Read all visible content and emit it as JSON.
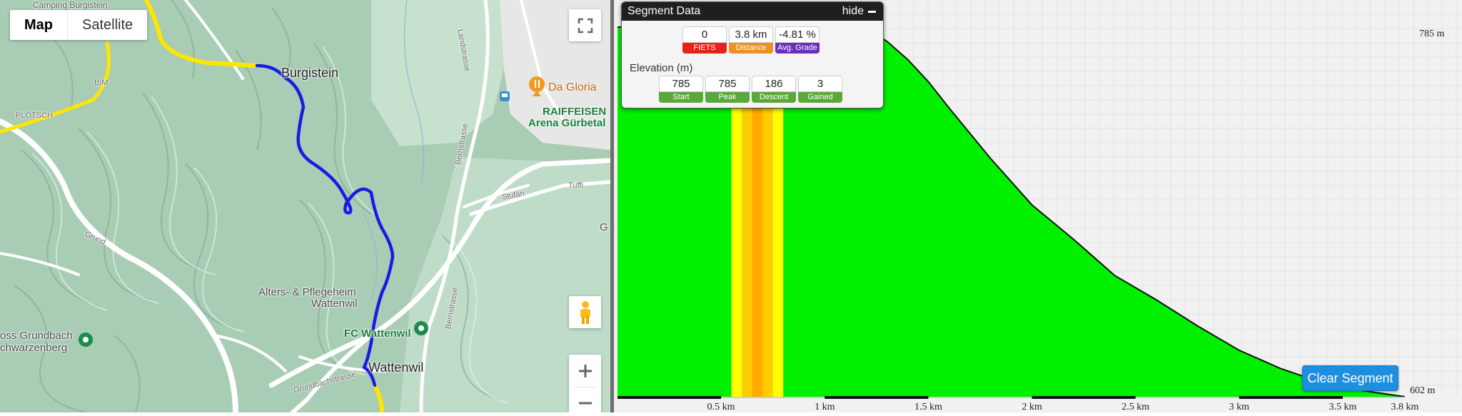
{
  "map": {
    "map_type": {
      "map": "Map",
      "satellite": "Satellite"
    },
    "labels": {
      "burgistein": "Burgistein",
      "camping": "Camping Burgistein",
      "da_gloria": "Da Gloria",
      "raiffeisen_1": "RAIFFEISEN",
      "raiffeisen_2": "Arena Gürbetal",
      "alters_1": "Alters- & Pflegeheim",
      "alters_2": "Wattenwil",
      "fc_wattenwil": "FC Wattenwil",
      "wattenwil": "Wattenwil",
      "grundbach_1": "oss Grundbach",
      "grundbach_2": "chwarzenberg",
      "plotsch": "PLÖTSCH",
      "bim": "BIM",
      "landstrasse": "Landstrasse",
      "bernstrasse_1": "Bernstrasse",
      "bernstrasse_2": "Bernstrasse",
      "stufan": "Stufän",
      "tuffi": "Tuffi",
      "grund": "Grund",
      "grundbachstrasse": "Grundbachstrasse",
      "g_edge": "G"
    },
    "icons": [
      "fullscreen-icon",
      "pegman-icon",
      "zoom-in-icon",
      "zoom-out-icon",
      "restaurant-pin-icon",
      "green-place-pin-icon"
    ]
  },
  "segment": {
    "title": "Segment Data",
    "hide_label": "hide",
    "stats": [
      {
        "value": "0",
        "label": "FIETS",
        "color": "#e8221b"
      },
      {
        "value": "3.8 km",
        "label": "Distance",
        "color": "#f0901e"
      },
      {
        "value": "-4.81 %",
        "label": "Avg. Grade",
        "color": "#6a2fc1"
      }
    ],
    "elevation_label": "Elevation (m)",
    "elevation": [
      {
        "value": "785",
        "label": "Start",
        "color": "#5aa83a"
      },
      {
        "value": "785",
        "label": "Peak",
        "color": "#5aa83a"
      },
      {
        "value": "186",
        "label": "Descent",
        "color": "#5aa83a"
      },
      {
        "value": "3",
        "label": "Gained",
        "color": "#5aa83a"
      }
    ]
  },
  "clear_segment_label": "Clear Segment",
  "chart_data": {
    "type": "area",
    "y_top_label": "785 m",
    "y_bottom_label": "602 m",
    "ylim": [
      602,
      785
    ],
    "xlim": [
      0,
      3.8
    ],
    "fill_color": "#00f000",
    "highlight_band": {
      "x_range": [
        0.55,
        0.8
      ],
      "colors": [
        "#ffff00",
        "#ffcc00",
        "#ffaa00"
      ]
    },
    "x_ticks": [
      {
        "x": 0.5,
        "label": "0.5 km"
      },
      {
        "x": 1.0,
        "label": "1 km"
      },
      {
        "x": 1.5,
        "label": "1.5 km"
      },
      {
        "x": 2.0,
        "label": "2 km"
      },
      {
        "x": 2.5,
        "label": "2.5 km"
      },
      {
        "x": 3.0,
        "label": "3 km"
      },
      {
        "x": 3.5,
        "label": "3.5 km"
      },
      {
        "x": 3.8,
        "label": "3.8 km"
      }
    ],
    "profile": [
      [
        0.0,
        785
      ],
      [
        0.5,
        785
      ],
      [
        1.0,
        785
      ],
      [
        1.2,
        784
      ],
      [
        1.3,
        778
      ],
      [
        1.4,
        769
      ],
      [
        1.5,
        758
      ],
      [
        1.6,
        745
      ],
      [
        1.8,
        720
      ],
      [
        2.0,
        697
      ],
      [
        2.2,
        680
      ],
      [
        2.4,
        662
      ],
      [
        2.6,
        650
      ],
      [
        2.8,
        637
      ],
      [
        3.0,
        625
      ],
      [
        3.2,
        616
      ],
      [
        3.4,
        609
      ],
      [
        3.6,
        605
      ],
      [
        3.8,
        602
      ]
    ]
  }
}
